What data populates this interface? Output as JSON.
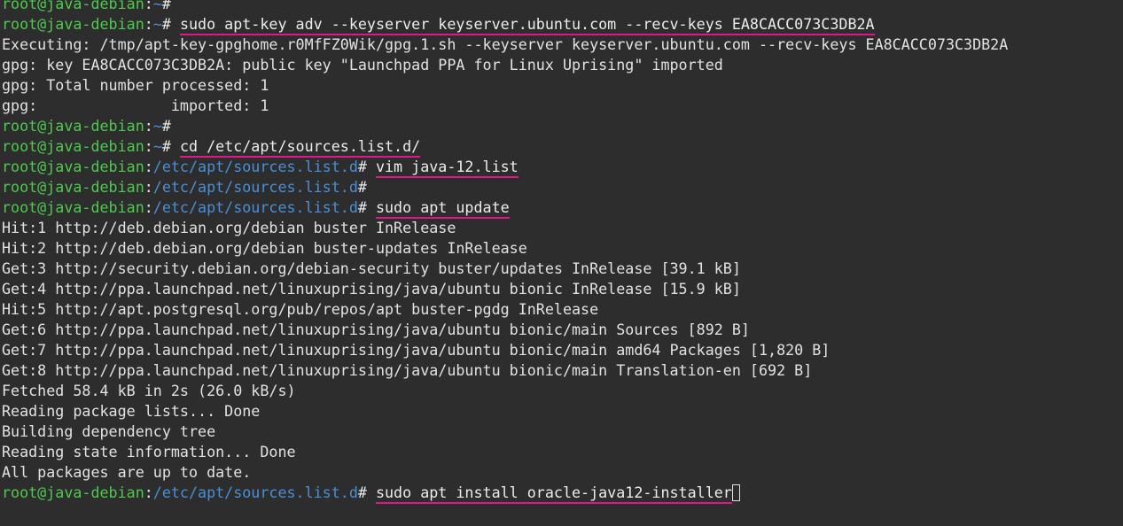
{
  "prompt": {
    "user_host": "root@java-debian",
    "colon": ":",
    "home": "~",
    "symbol": "#"
  },
  "lines": [
    {
      "type": "prompt",
      "path": "~",
      "command": ""
    },
    {
      "type": "prompt",
      "path": "~",
      "command": "sudo apt-key adv --keyserver keyserver.ubuntu.com --recv-keys EA8CACC073C3DB2A"
    },
    {
      "type": "output",
      "text": "Executing: /tmp/apt-key-gpghome.r0MfFZ0Wik/gpg.1.sh --keyserver keyserver.ubuntu.com --recv-keys EA8CACC073C3DB2A"
    },
    {
      "type": "output",
      "text": "gpg: key EA8CACC073C3DB2A: public key \"Launchpad PPA for Linux Uprising\" imported"
    },
    {
      "type": "output",
      "text": "gpg: Total number processed: 1"
    },
    {
      "type": "output",
      "text": "gpg:               imported: 1"
    },
    {
      "type": "prompt",
      "path": "~",
      "command": ""
    },
    {
      "type": "prompt",
      "path": "~",
      "command": "cd /etc/apt/sources.list.d/"
    },
    {
      "type": "prompt",
      "path": "/etc/apt/sources.list.d",
      "command": "vim java-12.list"
    },
    {
      "type": "prompt",
      "path": "/etc/apt/sources.list.d",
      "command": ""
    },
    {
      "type": "prompt",
      "path": "/etc/apt/sources.list.d",
      "command": "sudo apt update"
    },
    {
      "type": "output",
      "text": "Hit:1 http://deb.debian.org/debian buster InRelease"
    },
    {
      "type": "output",
      "text": "Hit:2 http://deb.debian.org/debian buster-updates InRelease"
    },
    {
      "type": "output",
      "text": "Get:3 http://security.debian.org/debian-security buster/updates InRelease [39.1 kB]"
    },
    {
      "type": "output",
      "text": "Get:4 http://ppa.launchpad.net/linuxuprising/java/ubuntu bionic InRelease [15.9 kB]"
    },
    {
      "type": "output",
      "text": "Hit:5 http://apt.postgresql.org/pub/repos/apt buster-pgdg InRelease"
    },
    {
      "type": "output",
      "text": "Get:6 http://ppa.launchpad.net/linuxuprising/java/ubuntu bionic/main Sources [892 B]"
    },
    {
      "type": "output",
      "text": "Get:7 http://ppa.launchpad.net/linuxuprising/java/ubuntu bionic/main amd64 Packages [1,820 B]"
    },
    {
      "type": "output",
      "text": "Get:8 http://ppa.launchpad.net/linuxuprising/java/ubuntu bionic/main Translation-en [692 B]"
    },
    {
      "type": "output",
      "text": "Fetched 58.4 kB in 2s (26.0 kB/s)"
    },
    {
      "type": "output",
      "text": "Reading package lists... Done"
    },
    {
      "type": "output",
      "text": "Building dependency tree"
    },
    {
      "type": "output",
      "text": "Reading state information... Done"
    },
    {
      "type": "output",
      "text": "All packages are up to date."
    },
    {
      "type": "prompt",
      "path": "/etc/apt/sources.list.d",
      "command": "sudo apt install oracle-java12-installer",
      "cursor": true
    }
  ],
  "colors": {
    "background": "#2d2d2d",
    "user_host": "#4ec94e",
    "path": "#4a8fd6",
    "text": "#e8e8e8",
    "highlight_underline": "#e0168a"
  }
}
